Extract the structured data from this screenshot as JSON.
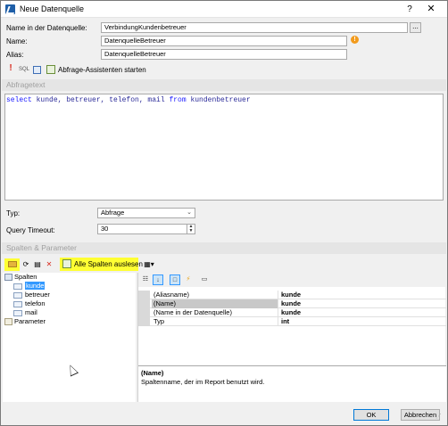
{
  "window": {
    "title": "Neue Datenquelle",
    "help": "?",
    "close": "✕"
  },
  "form": {
    "name_in_source_label": "Name in der Datenquelle:",
    "name_in_source_value": "VerbindungKundenbetreuer",
    "browse_label": "...",
    "name_label": "Name:",
    "name_value": "DatenquelleBetreuer",
    "warning_icon": "!",
    "alias_label": "Alias:",
    "alias_value": "DatenquelleBetreuer"
  },
  "query_toolbar": {
    "run_icon": "!",
    "sql_icon": "SQL",
    "assistant_label": "Abfrage-Assistenten starten"
  },
  "query": {
    "header": "Abfragetext",
    "tokens": [
      {
        "text": "select",
        "kind": "kw"
      },
      {
        "text": " kunde, betreuer, telefon, mail ",
        "kind": "id"
      },
      {
        "text": "from",
        "kind": "kw"
      },
      {
        "text": " kundenbetreuer",
        "kind": "id"
      }
    ],
    "type_label": "Typ:",
    "type_value": "Abfrage",
    "timeout_label": "Query Timeout:",
    "timeout_value": "30"
  },
  "columns": {
    "header": "Spalten & Parameter",
    "read_all_label": "Alle Spalten auslesen",
    "tree": {
      "columns_node": "Spalten",
      "items": [
        "kunde",
        "betreuer",
        "telefon",
        "mail"
      ],
      "selected_index": 0,
      "params_node": "Parameter"
    }
  },
  "properties": {
    "rows": [
      {
        "name": "(Aliasname)",
        "value": "kunde",
        "selected": false
      },
      {
        "name": "(Name)",
        "value": "kunde",
        "selected": true
      },
      {
        "name": "(Name in der Datenquelle)",
        "value": "kunde",
        "selected": false
      },
      {
        "name": "Typ",
        "value": "int",
        "selected": false
      }
    ],
    "desc_title": "(Name)",
    "desc_text": "Spaltenname, der im Report benutzt wird."
  },
  "footer": {
    "ok": "OK",
    "cancel": "Abbrechen"
  },
  "colors": {
    "highlight": "#ffff33",
    "selection": "#3399ff",
    "keyword": "#1a1aff"
  }
}
